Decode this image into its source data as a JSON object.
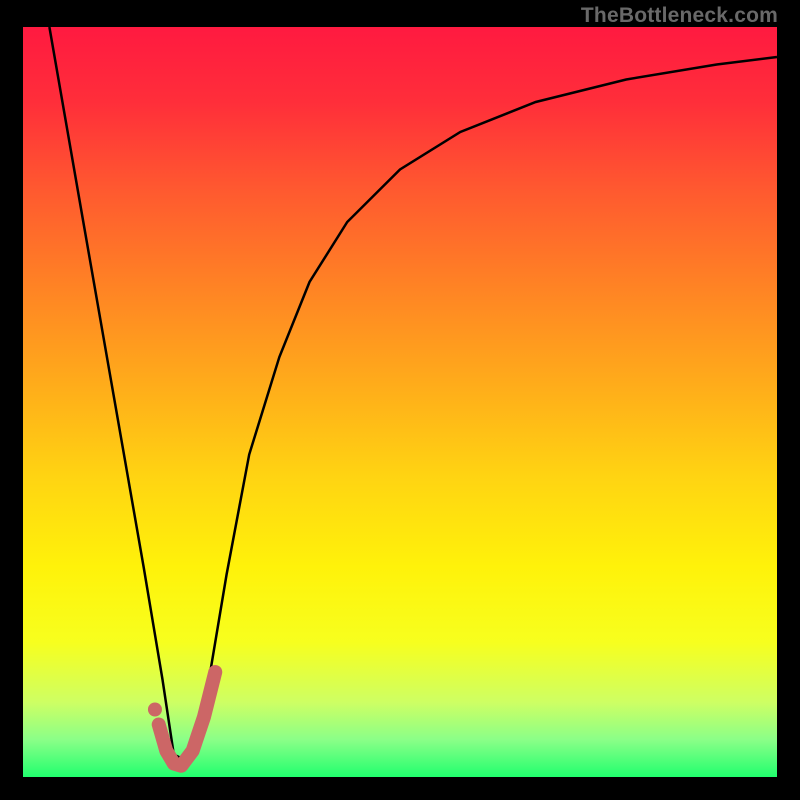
{
  "watermark": "TheBottleneck.com",
  "gradient": {
    "stops": [
      {
        "offset": 0.0,
        "color": "#ff1a40"
      },
      {
        "offset": 0.1,
        "color": "#ff2e3a"
      },
      {
        "offset": 0.22,
        "color": "#ff5a2f"
      },
      {
        "offset": 0.35,
        "color": "#ff8424"
      },
      {
        "offset": 0.48,
        "color": "#ffad1a"
      },
      {
        "offset": 0.6,
        "color": "#ffd412"
      },
      {
        "offset": 0.72,
        "color": "#fff20a"
      },
      {
        "offset": 0.82,
        "color": "#f7ff1e"
      },
      {
        "offset": 0.9,
        "color": "#ceff63"
      },
      {
        "offset": 0.95,
        "color": "#8bff88"
      },
      {
        "offset": 1.0,
        "color": "#21ff6e"
      }
    ]
  },
  "chart_data": {
    "type": "line",
    "title": "",
    "xlabel": "",
    "ylabel": "",
    "xlim": [
      0,
      100
    ],
    "ylim": [
      0,
      100
    ],
    "grid": false,
    "series": [
      {
        "name": "bottleneck-curve",
        "color": "#000000",
        "stroke_width": 2.5,
        "x": [
          3.5,
          8,
          12,
          16,
          18.5,
          20,
          22,
          24,
          27,
          30,
          34,
          38,
          43,
          50,
          58,
          68,
          80,
          92,
          100
        ],
        "values": [
          100,
          74,
          51,
          28,
          13,
          3,
          2,
          9,
          27,
          43,
          56,
          66,
          74,
          81,
          86,
          90,
          93,
          95,
          96
        ]
      },
      {
        "name": "highlight-hook",
        "color": "#cc6666",
        "stroke_width": 14,
        "linecap": "round",
        "x": [
          18.0,
          19.0,
          20.0,
          21.0,
          22.5,
          24.0,
          25.5
        ],
        "values": [
          7.0,
          3.5,
          1.8,
          1.5,
          3.5,
          8.0,
          14.0
        ]
      }
    ],
    "points": [
      {
        "name": "highlight-dot",
        "x": 17.5,
        "y": 9.0,
        "r": 7,
        "color": "#cc6666"
      }
    ]
  }
}
